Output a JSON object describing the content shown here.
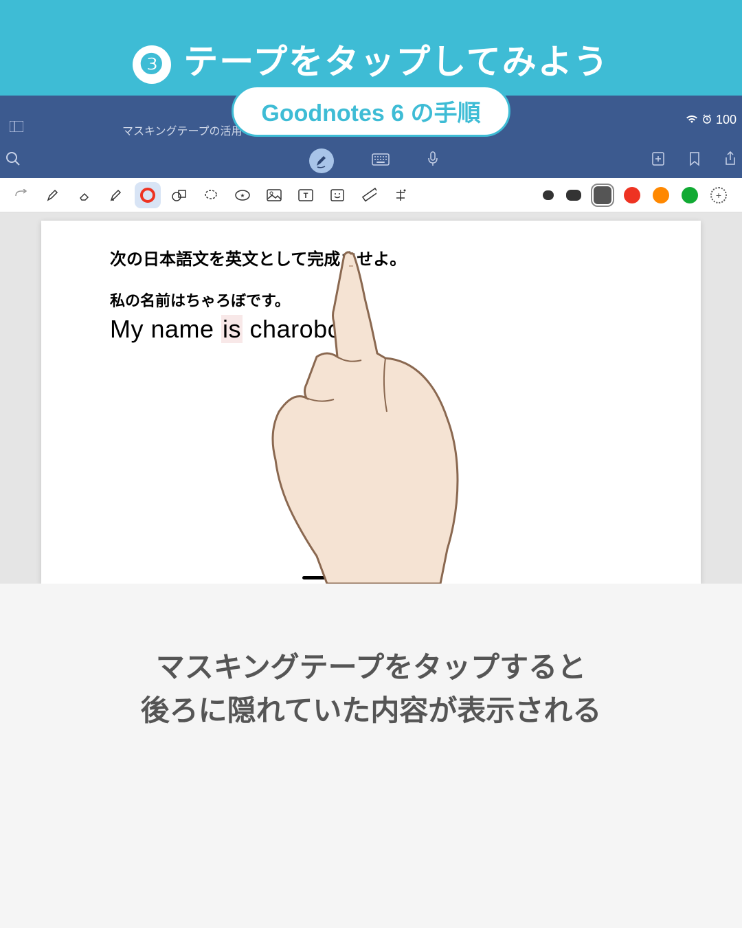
{
  "header": {
    "step_number": "❸",
    "title": "テープをタップしてみよう"
  },
  "badge": {
    "label": "Goodnotes 6 の手順"
  },
  "ios_status": {
    "battery": "100"
  },
  "app": {
    "tab_title": "マスキングテープの活用",
    "tab_chevron": "⌄",
    "tab_close": "×"
  },
  "page_content": {
    "instruction": "次の日本語文を英文として完成させよ。",
    "japanese": "私の名前はちゃろぼです。",
    "english_before": "My name ",
    "english_taped": "is",
    "english_after": " charobo."
  },
  "colors": {
    "selected": "#555",
    "red": "#ee3322",
    "orange": "#ff8800",
    "green": "#11aa33"
  },
  "caption": {
    "line1": "マスキングテープをタップすると",
    "line2": "後ろに隠れていた内容が表示される"
  }
}
